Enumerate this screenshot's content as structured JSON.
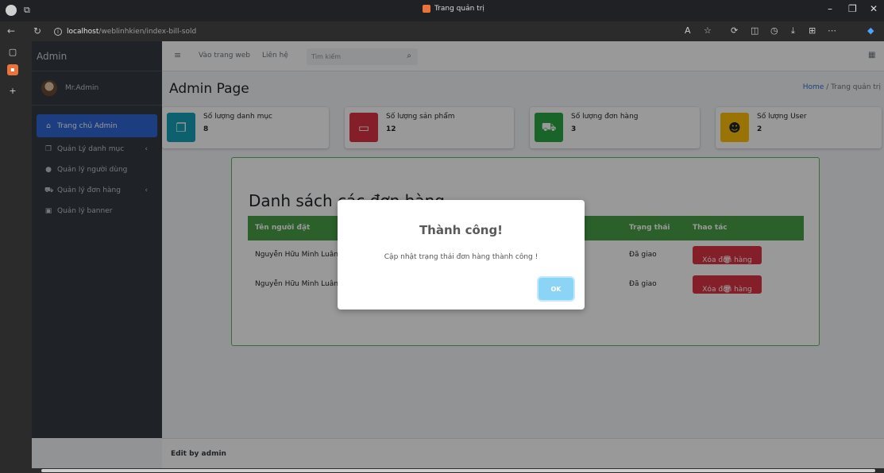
{
  "browser": {
    "tab_title": "Trang quản trị",
    "url_host": "localhost",
    "url_path": "/weblinhkien/index-bill-sold"
  },
  "sidebar": {
    "brand": "Admin",
    "user_name": "Mr.Admin",
    "items": [
      {
        "label": "Trang chủ Admin",
        "icon": "home-icon"
      },
      {
        "label": "Quản Lý danh mục",
        "icon": "copy-icon"
      },
      {
        "label": "Quản lý người dùng",
        "icon": "user-icon"
      },
      {
        "label": "Quản lý đơn hàng",
        "icon": "cart-icon"
      },
      {
        "label": "Quản lý banner",
        "icon": "image-icon"
      }
    ]
  },
  "topnav": {
    "site_link": "Vào trang web",
    "contact_link": "Liên hệ",
    "search_placeholder": "Tìm kiếm"
  },
  "page": {
    "title": "Admin Page",
    "breadcrumb_home": "Home",
    "breadcrumb_current": "Trang quản trị"
  },
  "stats": [
    {
      "label": "Số lượng danh mục",
      "value": "8",
      "color": "#17a2b8"
    },
    {
      "label": "Số lượng sản phẩm",
      "value": "12",
      "color": "#dc3545"
    },
    {
      "label": "Số lượng đơn hàng",
      "value": "3",
      "color": "#28a745"
    },
    {
      "label": "Số lượng User",
      "value": "2",
      "color": "#ffc107"
    }
  ],
  "orders": {
    "title": "Danh sách các đơn hàng",
    "headers": {
      "name": "Tên người đặt",
      "status": "Trạng thái",
      "action": "Thao tác"
    },
    "rows": [
      {
        "name": "Nguyễn Hữu Minh Luân",
        "status": "Đã giao",
        "action": "Xóa đơn hàng"
      },
      {
        "name": "Nguyễn Hữu Minh Luân",
        "status": "Đã giao",
        "action": "Xóa đơn hàng"
      }
    ]
  },
  "footer": {
    "text": "Edit by admin"
  },
  "modal": {
    "title": "Thành công!",
    "message": "Cập nhật trạng thái đơn hàng thành công !",
    "ok_label": "OK"
  }
}
